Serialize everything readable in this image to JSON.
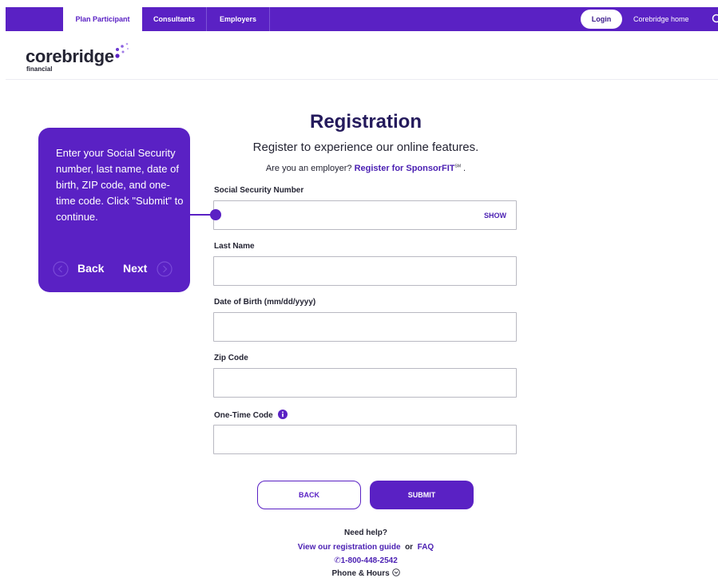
{
  "nav": {
    "tabs": [
      {
        "label": "Plan Participant",
        "active": true
      },
      {
        "label": "Consultants",
        "active": false
      },
      {
        "label": "Employers",
        "active": false
      }
    ],
    "login_label": "Login",
    "home_label": "Corebridge home",
    "search_icon": "search-icon"
  },
  "brand": {
    "name": "corebridge",
    "sub": "financial",
    "color": "#5a21c4"
  },
  "page": {
    "title": "Registration",
    "subtitle": "Register to experience our online features.",
    "employer_prompt": "Are you an employer?",
    "employer_link": "Register for SponsorFIT",
    "employer_tm": "SM",
    "employer_end": "."
  },
  "form": {
    "ssn_label": "Social Security Number",
    "ssn_value": "",
    "show_label": "SHOW",
    "last_name_label": "Last Name",
    "last_name_value": "",
    "dob_label": "Date of Birth (mm/dd/yyyy)",
    "dob_value": "",
    "zip_label": "Zip Code",
    "zip_value": "",
    "otc_label": "One-Time Code",
    "otc_value": "",
    "info_icon": "info-icon"
  },
  "actions": {
    "back_label": "BACK",
    "submit_label": "SUBMIT"
  },
  "help": {
    "title": "Need help?",
    "guide_link": "View our registration guide",
    "or_text": "or",
    "faq_link": "FAQ",
    "phone": "1-800-448-2542",
    "hours_label": "Phone & Hours"
  },
  "tooltip": {
    "text": "Enter your Social Security number, last name, date of birth, ZIP code, and one-time code. Click \"Submit\" to continue.",
    "back_label": "Back",
    "next_label": "Next"
  }
}
